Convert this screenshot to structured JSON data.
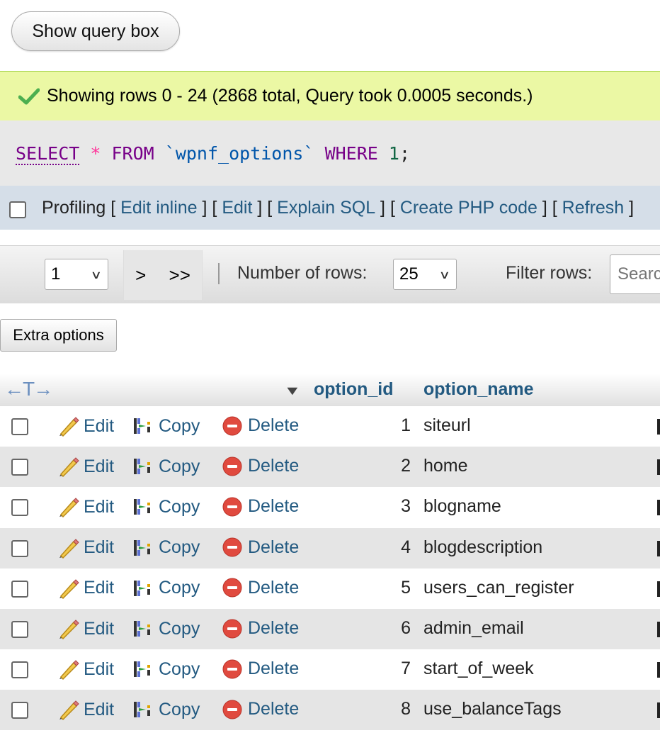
{
  "query_toggle": {
    "label": "Show query box"
  },
  "message": {
    "text": "Showing rows 0 - 24 (2868 total, Query took 0.0005 seconds.)"
  },
  "sql": {
    "select": "SELECT",
    "star": "*",
    "from": "FROM",
    "table": "`wpnf_options`",
    "where": "WHERE",
    "value": "1",
    "end": ";"
  },
  "tools": {
    "profiling": "Profiling",
    "edit_inline": "Edit inline",
    "edit": "Edit",
    "explain": "Explain SQL",
    "php": "Create PHP code",
    "refresh": "Refresh"
  },
  "nav": {
    "page": "1",
    "next": ">",
    "last": ">>",
    "rows_label": "Number of rows:",
    "rows_value": "25",
    "filter_label": "Filter rows:",
    "filter_placeholder": "Search this table"
  },
  "extra": {
    "label": "Extra options"
  },
  "table": {
    "arrows": "←T→",
    "columns": [
      "option_id",
      "option_name"
    ],
    "actions": {
      "edit": "Edit",
      "copy": "Copy",
      "delete": "Delete"
    },
    "rows": [
      {
        "id": "1",
        "name": "siteurl"
      },
      {
        "id": "2",
        "name": "home"
      },
      {
        "id": "3",
        "name": "blogname"
      },
      {
        "id": "4",
        "name": "blogdescription"
      },
      {
        "id": "5",
        "name": "users_can_register"
      },
      {
        "id": "6",
        "name": "admin_email"
      },
      {
        "id": "7",
        "name": "start_of_week"
      },
      {
        "id": "8",
        "name": "use_balanceTags"
      }
    ]
  },
  "colors": {
    "link": "#235a81",
    "success_bg": "#ebf8a4",
    "row_alt": "#e5e5e5"
  }
}
